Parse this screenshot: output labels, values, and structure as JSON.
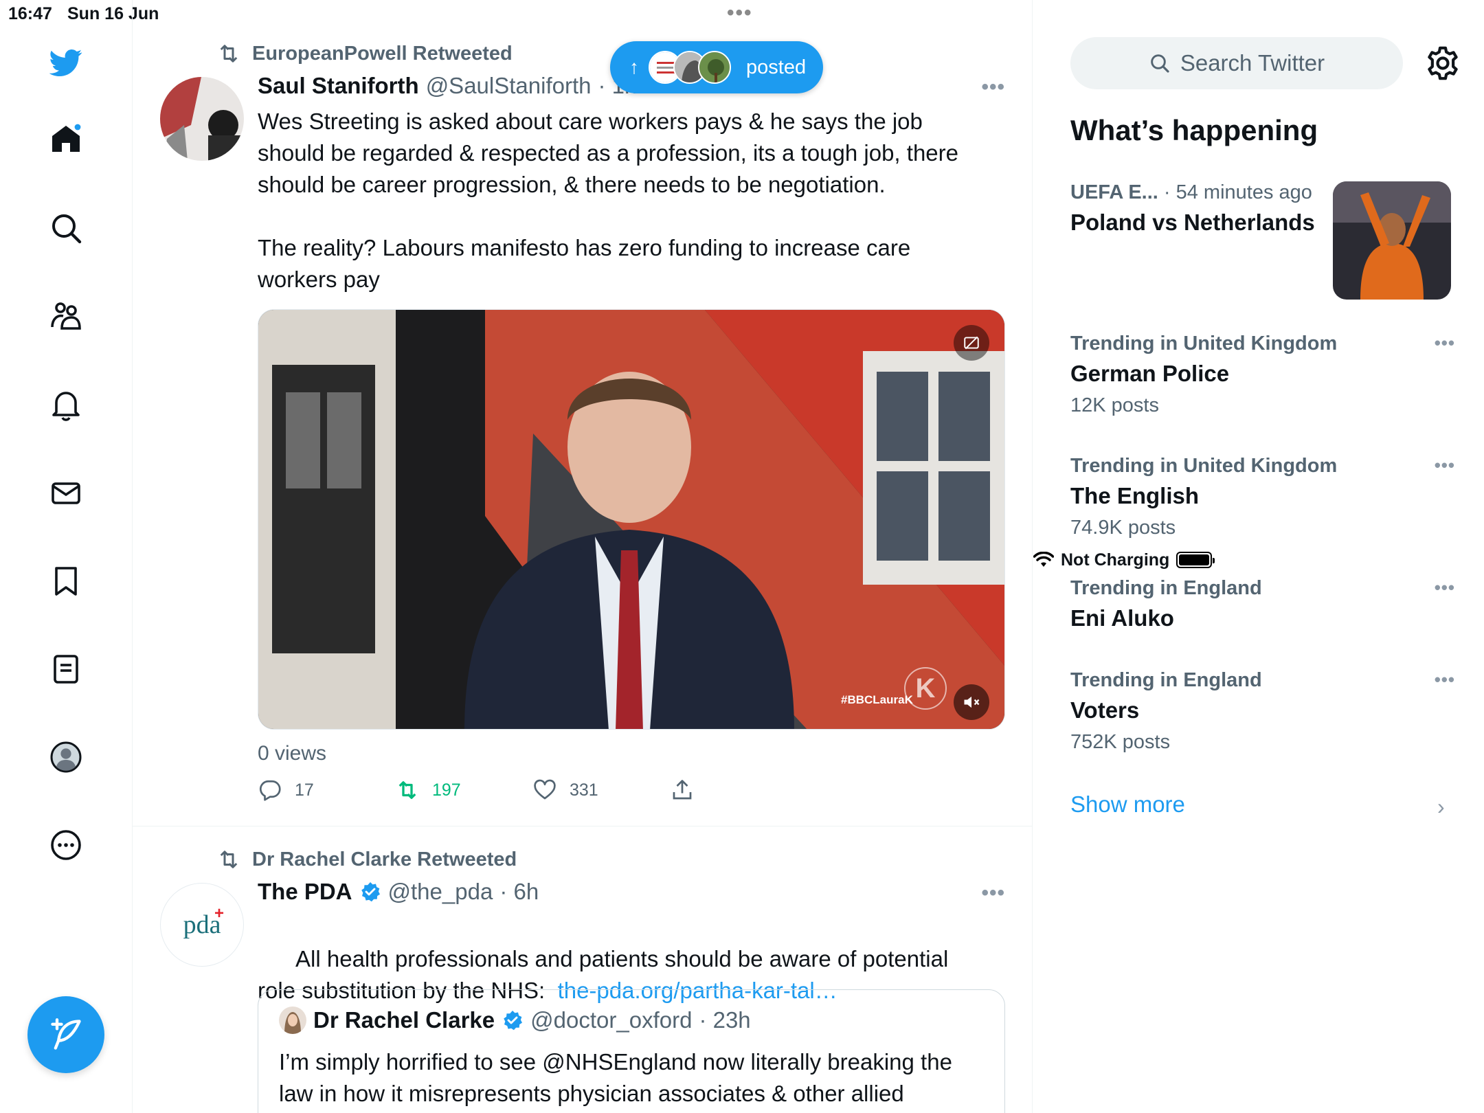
{
  "status_bar": {
    "time": "16:47",
    "date": "Sun 16 Jun",
    "battery_text": "Not Charging"
  },
  "nav": {
    "icons": [
      "twitter-bird-icon",
      "home-icon",
      "search-icon",
      "communities-icon",
      "notifications-icon",
      "messages-icon",
      "bookmarks-icon",
      "lists-icon",
      "profile-icon",
      "more-icon"
    ],
    "accent": "#1d9bf0"
  },
  "pill": {
    "label": "posted"
  },
  "tweets": [
    {
      "retweeted_by": "EuropeanPowell Retweeted",
      "name": "Saul Staniforth",
      "handle": "@SaulStaniforth",
      "time": "· 1h",
      "text": "Wes Streeting is asked about care workers pays & he says the job should be regarded & respected as a profession, its a tough job, there should be career progression, & there needs to be negotiation.\n\nThe reality? Labours manifesto has zero funding to increase care workers pay",
      "media_caption": "#BBCLauraK",
      "views": "0 views",
      "replies": "17",
      "retweets": "197",
      "likes": "331"
    },
    {
      "retweeted_by": "Dr Rachel Clarke Retweeted",
      "name": "The PDA",
      "handle": "@the_pda",
      "time": "· 6h",
      "avatar_text": "pda",
      "text": "All health professionals and patients should be aware of potential role substitution by the NHS:",
      "link": "the-pda.org/partha-kar-tal…",
      "quote": {
        "name": "Dr Rachel Clarke",
        "handle": "@doctor_oxford",
        "time": "· 23h",
        "text": "I’m simply horrified to see @NHSEngland now literally breaking the law in how it misrepresents physician associates & other allied"
      }
    }
  ],
  "sidebar": {
    "search_placeholder": "Search Twitter",
    "section_title": "What’s happening",
    "featured": {
      "category": "UEFA E...",
      "time": "· 54 minutes ago",
      "title": "Poland vs Netherlands"
    },
    "trends": [
      {
        "context": "Trending in United Kingdom",
        "title": "German Police",
        "count": "12K posts"
      },
      {
        "context": "Trending in United Kingdom",
        "title": "The English",
        "count": "74.9K posts"
      },
      {
        "context": "Trending in England",
        "title": "Eni Aluko",
        "count": ""
      },
      {
        "context": "Trending in England",
        "title": "Voters",
        "count": "752K posts"
      }
    ],
    "show_more": "Show more"
  }
}
